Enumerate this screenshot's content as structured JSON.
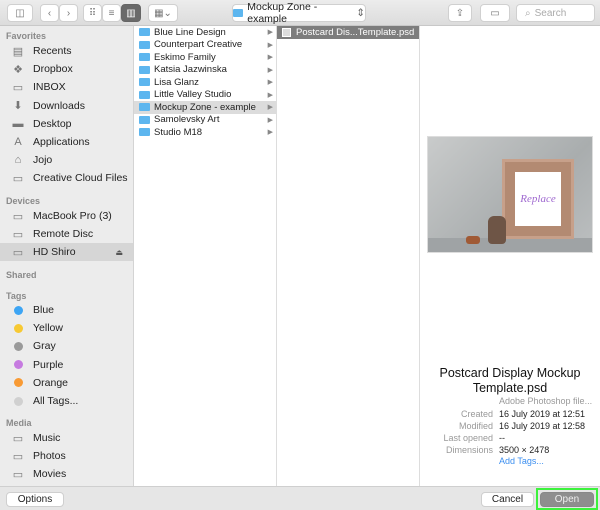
{
  "toolbar": {
    "path": "Mockup Zone - example",
    "search_placeholder": "Search"
  },
  "sidebar": {
    "favorites_header": "Favorites",
    "favorites": [
      {
        "label": "Recents",
        "icon": "recents-icon"
      },
      {
        "label": "Dropbox",
        "icon": "dropbox-icon"
      },
      {
        "label": "INBOX",
        "icon": "folder-icon"
      },
      {
        "label": "Downloads",
        "icon": "downloads-icon"
      },
      {
        "label": "Desktop",
        "icon": "desktop-icon"
      },
      {
        "label": "Applications",
        "icon": "applications-icon"
      },
      {
        "label": "Jojo",
        "icon": "home-icon"
      },
      {
        "label": "Creative Cloud Files",
        "icon": "folder-icon"
      }
    ],
    "devices_header": "Devices",
    "devices": [
      {
        "label": "MacBook Pro (3)"
      },
      {
        "label": "Remote Disc"
      },
      {
        "label": "HD Shiro",
        "selected": true
      }
    ],
    "shared_header": "Shared",
    "tags_header": "Tags",
    "tags": [
      {
        "label": "Blue",
        "color": "#3da5f4"
      },
      {
        "label": "Yellow",
        "color": "#f7c933"
      },
      {
        "label": "Gray",
        "color": "#9a9a9a"
      },
      {
        "label": "Purple",
        "color": "#c67be0"
      },
      {
        "label": "Orange",
        "color": "#f89a34"
      },
      {
        "label": "All Tags...",
        "color": "#d0d0d0"
      }
    ],
    "media_header": "Media",
    "media": [
      {
        "label": "Music"
      },
      {
        "label": "Photos"
      },
      {
        "label": "Movies"
      }
    ]
  },
  "column1": [
    "Blue Line Design",
    "Counterpart Creative",
    "Eskimo Family",
    "Katsia Jazwinska",
    "Lisa Glanz",
    "Little Valley Studio",
    "Mockup Zone - example",
    "Samolevsky Art",
    "Studio M18"
  ],
  "column1_selected": 6,
  "column2": [
    "Postcard Dis...Template.psd"
  ],
  "preview": {
    "image_text": "Replace",
    "title_line1": "Postcard Display Mockup",
    "title_line2": "Template.psd",
    "kind": "Adobe Photoshop file...",
    "fields": [
      {
        "k": "Created",
        "v": "16 July 2019 at 12:51"
      },
      {
        "k": "Modified",
        "v": "16 July 2019 at 12:58"
      },
      {
        "k": "Last opened",
        "v": "--"
      },
      {
        "k": "Dimensions",
        "v": "3500 × 2478"
      }
    ],
    "add_tags": "Add Tags..."
  },
  "buttons": {
    "options": "Options",
    "cancel": "Cancel",
    "open": "Open"
  }
}
